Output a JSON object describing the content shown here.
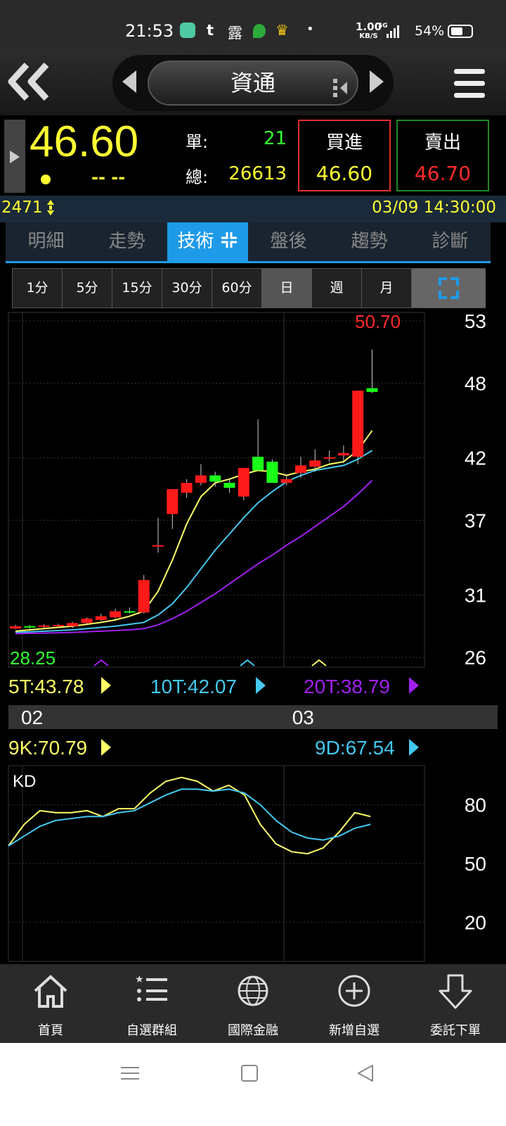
{
  "status_bar": {
    "time": "21:53",
    "icon_t": "t",
    "icon_lu": "露",
    "dot": "•",
    "speed_value": "1.00",
    "speed_unit": "KB/S",
    "signal_type": "5G",
    "battery": "54%"
  },
  "header": {
    "title": "資通"
  },
  "quote": {
    "last_price": "46.60",
    "change": "-- --",
    "volume_label": "單:",
    "volume": "21",
    "total_label": "總:",
    "total": "26613",
    "buy_label": "買進",
    "buy_price": "46.60",
    "sell_label": "賣出",
    "sell_price": "46.70"
  },
  "info": {
    "code": "2471",
    "datetime": "03/09 14:30:00"
  },
  "tabs": [
    {
      "label": "明細"
    },
    {
      "label": "走勢"
    },
    {
      "label": "技術",
      "active": true
    },
    {
      "label": "盤後"
    },
    {
      "label": "趨勢"
    },
    {
      "label": "診斷"
    }
  ],
  "periods": [
    {
      "label": "1分"
    },
    {
      "label": "5分"
    },
    {
      "label": "15分"
    },
    {
      "label": "30分"
    },
    {
      "label": "60分"
    },
    {
      "label": "日",
      "active": true
    },
    {
      "label": "週"
    },
    {
      "label": "月"
    }
  ],
  "colors": {
    "up": "#ff1a1a",
    "down": "#1aff1a",
    "ma5": "#ffff66",
    "ma10": "#44c8f0",
    "ma20": "#a020f0",
    "k": "#ffff66",
    "d": "#44c8f0",
    "accent": "#1e9be8",
    "price": "#ffff33"
  },
  "chart_data": [
    {
      "type": "candlestick",
      "y_ticks": [
        "53",
        "48",
        "42",
        "37",
        "31",
        "26"
      ],
      "ylim": [
        26,
        53
      ],
      "x_labels": [
        {
          "label": "02",
          "index": 0
        },
        {
          "label": "03",
          "index": 19
        }
      ],
      "max_label": "50.70",
      "min_label": "28.25",
      "ohlc": [
        [
          28.3,
          28.6,
          28.25,
          28.5
        ],
        [
          28.5,
          28.6,
          28.3,
          28.45
        ],
        [
          28.5,
          28.65,
          28.35,
          28.55
        ],
        [
          28.55,
          28.7,
          28.4,
          28.6
        ],
        [
          28.5,
          28.85,
          28.35,
          28.75
        ],
        [
          28.75,
          29.2,
          28.65,
          29.1
        ],
        [
          29.0,
          29.5,
          28.9,
          29.3
        ],
        [
          29.2,
          29.9,
          29.1,
          29.7
        ],
        [
          29.7,
          30.0,
          29.5,
          29.65
        ],
        [
          29.6,
          32.6,
          29.5,
          32.2
        ],
        [
          35.0,
          37.2,
          34.4,
          35.0
        ],
        [
          37.5,
          37.8,
          36.3,
          39.5
        ],
        [
          39.2,
          40.3,
          38.8,
          40.0
        ],
        [
          40.0,
          41.5,
          39.8,
          40.6
        ],
        [
          40.6,
          40.9,
          39.7,
          40.1
        ],
        [
          40.0,
          40.3,
          39.2,
          39.6
        ],
        [
          38.9,
          41.2,
          38.6,
          41.2
        ],
        [
          42.1,
          45.1,
          41.0,
          41.0
        ],
        [
          41.7,
          41.9,
          40.5,
          40.0
        ],
        [
          40.0,
          40.6,
          39.8,
          40.3
        ],
        [
          40.8,
          42.1,
          40.4,
          41.4
        ],
        [
          41.3,
          42.7,
          40.9,
          41.8
        ],
        [
          42.0,
          42.6,
          41.7,
          42.05
        ],
        [
          42.2,
          43.0,
          41.6,
          42.4
        ],
        [
          42.1,
          47.4,
          41.5,
          47.4
        ],
        [
          47.6,
          50.7,
          47.2,
          47.3
        ]
      ],
      "ma5": [
        28.1,
        28.2,
        28.3,
        28.4,
        28.5,
        28.65,
        28.8,
        29.0,
        29.3,
        29.7,
        31.3,
        33.8,
        36.7,
        38.9,
        40.0,
        40.3,
        40.7,
        41.0,
        40.9,
        40.6,
        40.9,
        41.1,
        41.5,
        41.7,
        42.6,
        44.2
      ],
      "ma10": [
        28.0,
        28.05,
        28.1,
        28.15,
        28.2,
        28.3,
        28.4,
        28.5,
        28.65,
        28.8,
        29.4,
        30.3,
        31.6,
        33.1,
        34.6,
        35.9,
        37.2,
        38.4,
        39.3,
        40.1,
        40.6,
        41.0,
        41.2,
        41.4,
        41.9,
        42.6
      ],
      "ma20": [
        27.9,
        27.92,
        27.94,
        27.97,
        28.0,
        28.05,
        28.1,
        28.15,
        28.2,
        28.3,
        28.6,
        29.1,
        29.7,
        30.4,
        31.1,
        31.9,
        32.7,
        33.5,
        34.2,
        35.0,
        35.7,
        36.5,
        37.3,
        38.1,
        39.1,
        40.2
      ],
      "legend": [
        {
          "label": "5T:43.78",
          "color": "#ffff66"
        },
        {
          "label": "10T:42.07",
          "color": "#44c8f0"
        },
        {
          "label": "20T:38.79",
          "color": "#a020f0"
        }
      ]
    },
    {
      "type": "line",
      "title": "KD",
      "y_ticks": [
        "80",
        "50",
        "20"
      ],
      "ylim": [
        0,
        100
      ],
      "series": [
        {
          "name": "9K:70.79",
          "values": [
            59,
            70,
            77,
            76,
            76,
            77,
            74,
            78,
            78,
            86,
            92,
            94,
            92,
            87,
            90,
            85,
            70,
            60,
            56,
            55,
            58,
            66,
            76,
            74
          ]
        },
        {
          "name": "9D:67.54",
          "values": [
            59,
            64,
            69,
            72,
            73,
            74,
            74,
            76,
            77,
            81,
            85,
            88,
            88,
            87,
            88,
            86,
            80,
            72,
            66,
            63,
            62,
            64,
            68,
            70
          ]
        }
      ]
    }
  ],
  "bottom_nav": [
    {
      "label": "首頁",
      "icon": "home-icon"
    },
    {
      "label": "自選群組",
      "icon": "list-icon"
    },
    {
      "label": "國際金融",
      "icon": "globe-icon"
    },
    {
      "label": "新增自選",
      "icon": "plus-circle-icon"
    },
    {
      "label": "委託下單",
      "icon": "order-arrow-icon"
    }
  ]
}
